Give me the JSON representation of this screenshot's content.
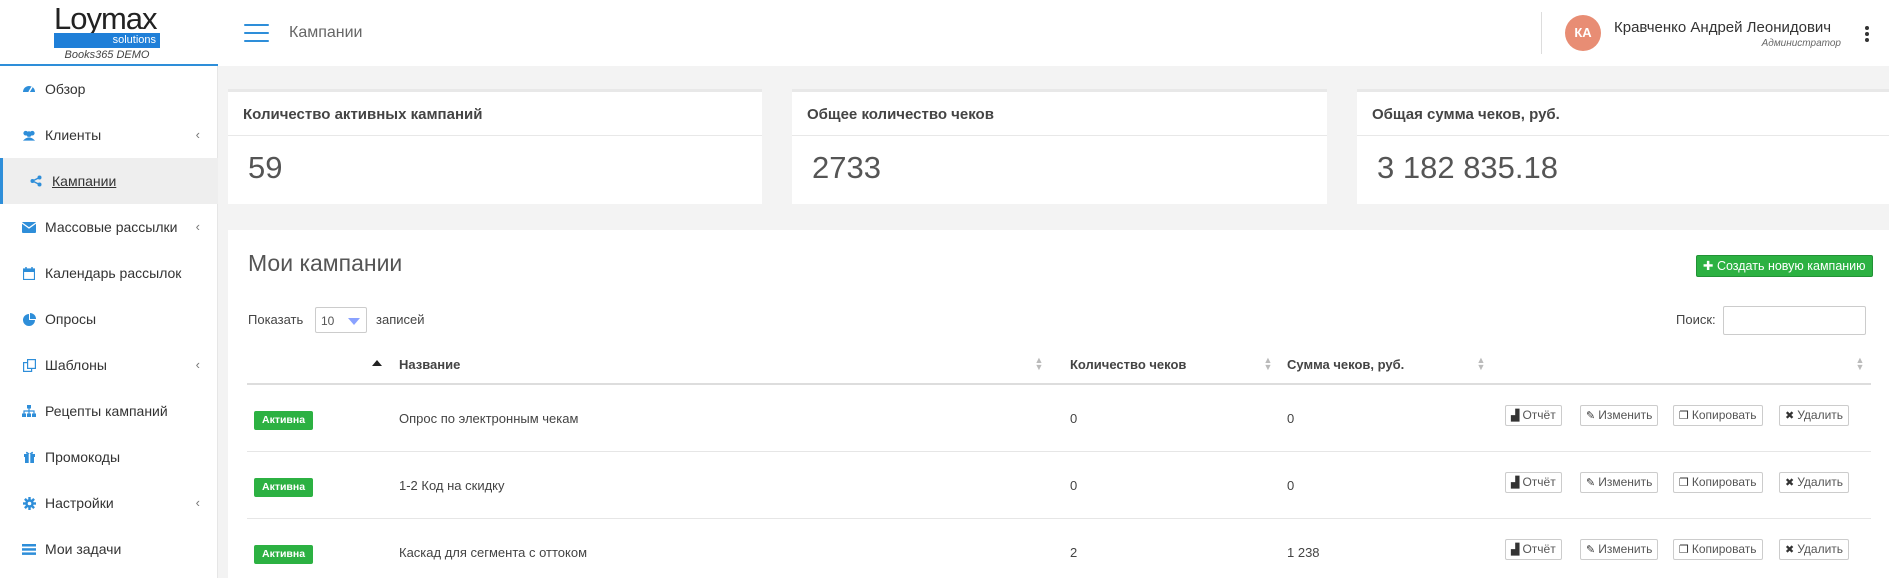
{
  "header": {
    "logo_text": "Loymax",
    "logo_sub": "solutions",
    "logo_demo": "Books365 DEMO",
    "page_title": "Кампании",
    "user_initials": "КА",
    "user_name": "Кравченко Андрей Леонидович",
    "user_role": "Администратор"
  },
  "sidebar": {
    "items": [
      {
        "label": "Обзор",
        "icon": "dashboard-icon",
        "has_arrow": false,
        "active": false
      },
      {
        "label": "Клиенты",
        "icon": "users-icon",
        "has_arrow": true,
        "active": false
      },
      {
        "label": "Кампании",
        "icon": "share-icon",
        "has_arrow": false,
        "active": true
      },
      {
        "label": "Массовые рассылки",
        "icon": "envelope-icon",
        "has_arrow": true,
        "active": false
      },
      {
        "label": "Календарь рассылок",
        "icon": "calendar-icon",
        "has_arrow": false,
        "active": false
      },
      {
        "label": "Опросы",
        "icon": "pie-chart-icon",
        "has_arrow": false,
        "active": false
      },
      {
        "label": "Шаблоны",
        "icon": "copy-icon",
        "has_arrow": true,
        "active": false
      },
      {
        "label": "Рецепты кампаний",
        "icon": "sitemap-icon",
        "has_arrow": false,
        "active": false
      },
      {
        "label": "Промокоды",
        "icon": "gift-icon",
        "has_arrow": false,
        "active": false
      },
      {
        "label": "Настройки",
        "icon": "gear-icon",
        "has_arrow": true,
        "active": false
      },
      {
        "label": "Мои задачи",
        "icon": "tasks-icon",
        "has_arrow": false,
        "active": false
      }
    ],
    "arrow_glyph": "‹"
  },
  "stats": [
    {
      "title": "Количество активных кампаний",
      "value": "59"
    },
    {
      "title": "Общее количество чеков",
      "value": "2733"
    },
    {
      "title": "Общая сумма чеков, руб.",
      "value": "3 182 835.18"
    }
  ],
  "campaigns": {
    "title": "Мои кампании",
    "create_label": "Создать новую кампанию",
    "show_label": "Показать",
    "page_size": "10",
    "records_label": "записей",
    "search_label": "Поиск:",
    "search_value": "",
    "columns": {
      "name": "Название",
      "count": "Количество чеков",
      "sum": "Сумма чеков, руб."
    },
    "actions": {
      "report": "Отчёт",
      "edit": "Изменить",
      "copy": "Копировать",
      "delete": "Удалить"
    },
    "rows": [
      {
        "status": "Активна",
        "name": "Опрос по электронным чекам",
        "count": "0",
        "sum": "0"
      },
      {
        "status": "Активна",
        "name": "1-2 Код на скидку",
        "count": "0",
        "sum": "0"
      },
      {
        "status": "Активна",
        "name": "Каскад для сегмента с оттоком",
        "count": "2",
        "sum": "1 238"
      }
    ]
  },
  "colors": {
    "accent": "#2e8ed9",
    "success": "#2cb142",
    "avatar": "#e88d74"
  }
}
